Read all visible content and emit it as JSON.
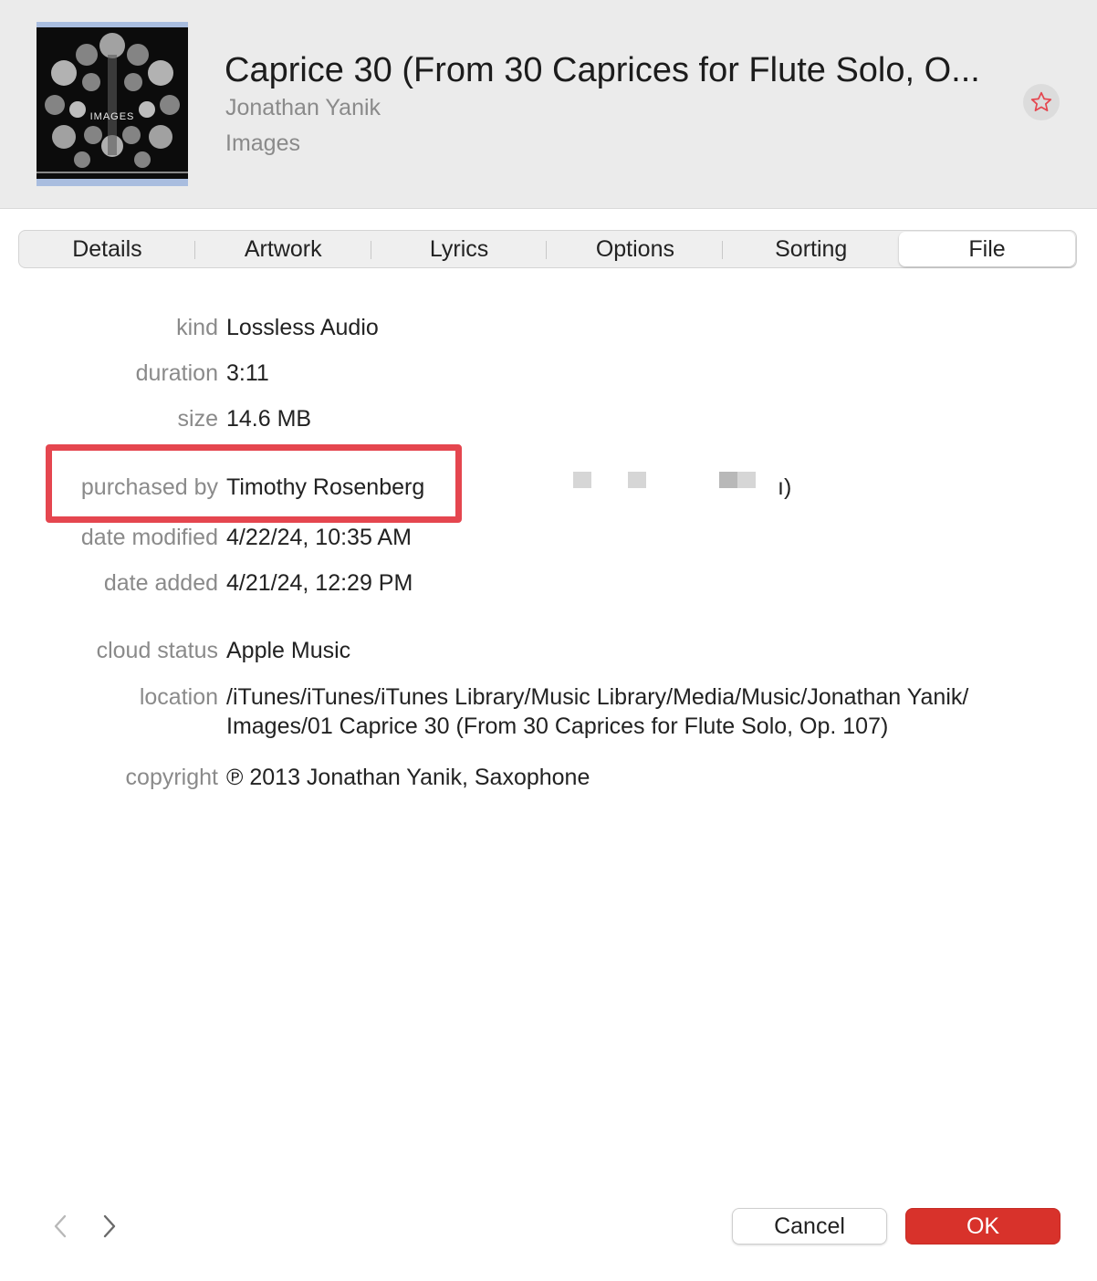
{
  "header": {
    "art_text": "IMAGES",
    "title": "Caprice 30 (From 30 Caprices for Flute Solo, O...",
    "artist": "Jonathan Yanik",
    "album": "Images"
  },
  "tabs": [
    {
      "label": "Details"
    },
    {
      "label": "Artwork"
    },
    {
      "label": "Lyrics"
    },
    {
      "label": "Options"
    },
    {
      "label": "Sorting"
    },
    {
      "label": "File",
      "active": true
    }
  ],
  "file": {
    "kind_label": "kind",
    "kind_value": "Lossless Audio",
    "duration_label": "duration",
    "duration_value": "3:11",
    "size_label": "size",
    "size_value": "14.6 MB",
    "purchased_label": "purchased by",
    "purchased_value": "Timothy Rosenberg",
    "purchased_tail": "ı)",
    "modified_label": "date modified",
    "modified_value": "4/22/24, 10:35 AM",
    "added_label": "date added",
    "added_value": "4/21/24, 12:29 PM",
    "cloud_label": "cloud status",
    "cloud_value": "Apple Music",
    "location_label": "location",
    "location_line1": "/iTunes/iTunes/iTunes Library/Music Library/Media/Music/Jonathan Yanik/",
    "location_line2": "Images/01 Caprice 30 (From 30 Caprices for Flute Solo, Op. 107)",
    "copyright_label": "copyright",
    "copyright_value": "℗ 2013 Jonathan Yanik, Saxophone"
  },
  "buttons": {
    "cancel": "Cancel",
    "ok": "OK"
  },
  "colors": {
    "accent": "#d8322b",
    "highlight": "#e5464f",
    "star": "#e5464f"
  },
  "icons": {
    "favorite": "star-outline-icon",
    "prev": "chevron-left-icon",
    "next": "chevron-right-icon"
  }
}
